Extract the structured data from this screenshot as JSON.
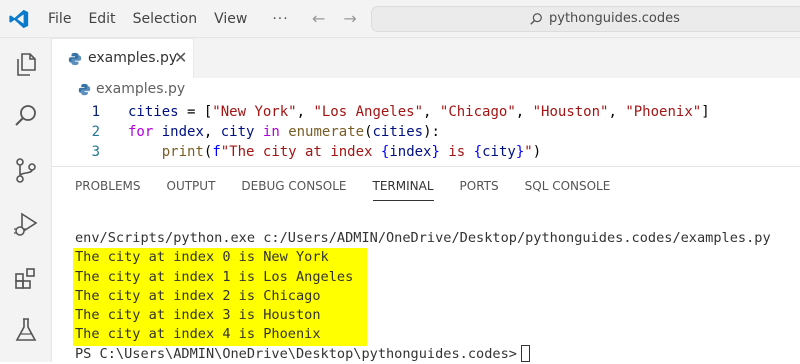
{
  "menu": {
    "items": [
      "File",
      "Edit",
      "Selection",
      "View"
    ],
    "more": "···"
  },
  "search": {
    "text": "pythonguides.codes"
  },
  "tab": {
    "label": "examples.py",
    "close": "✕"
  },
  "breadcrumb": {
    "file": "examples.py"
  },
  "editor": {
    "lines": [
      {
        "num": "1"
      },
      {
        "num": "2"
      },
      {
        "num": "3"
      }
    ]
  },
  "panel": {
    "tabs": [
      "PROBLEMS",
      "OUTPUT",
      "DEBUG CONSOLE",
      "TERMINAL",
      "PORTS",
      "SQL CONSOLE"
    ],
    "active_tab": "TERMINAL"
  },
  "terminal": {
    "command": "env/Scripts/python.exe c:/Users/ADMIN/OneDrive/Desktop/pythonguides.codes/examples.py",
    "output": [
      "The city at index 0 is New York",
      "The city at index 1 is Los Angeles",
      "The city at index 2 is Chicago",
      "The city at index 3 is Houston",
      "The city at index 4 is Phoenix"
    ],
    "prompt": "PS C:\\Users\\ADMIN\\OneDrive\\Desktop\\pythonguides.codes>"
  },
  "colors": {
    "highlight": "#ffff00",
    "accent": "#0078d4"
  }
}
